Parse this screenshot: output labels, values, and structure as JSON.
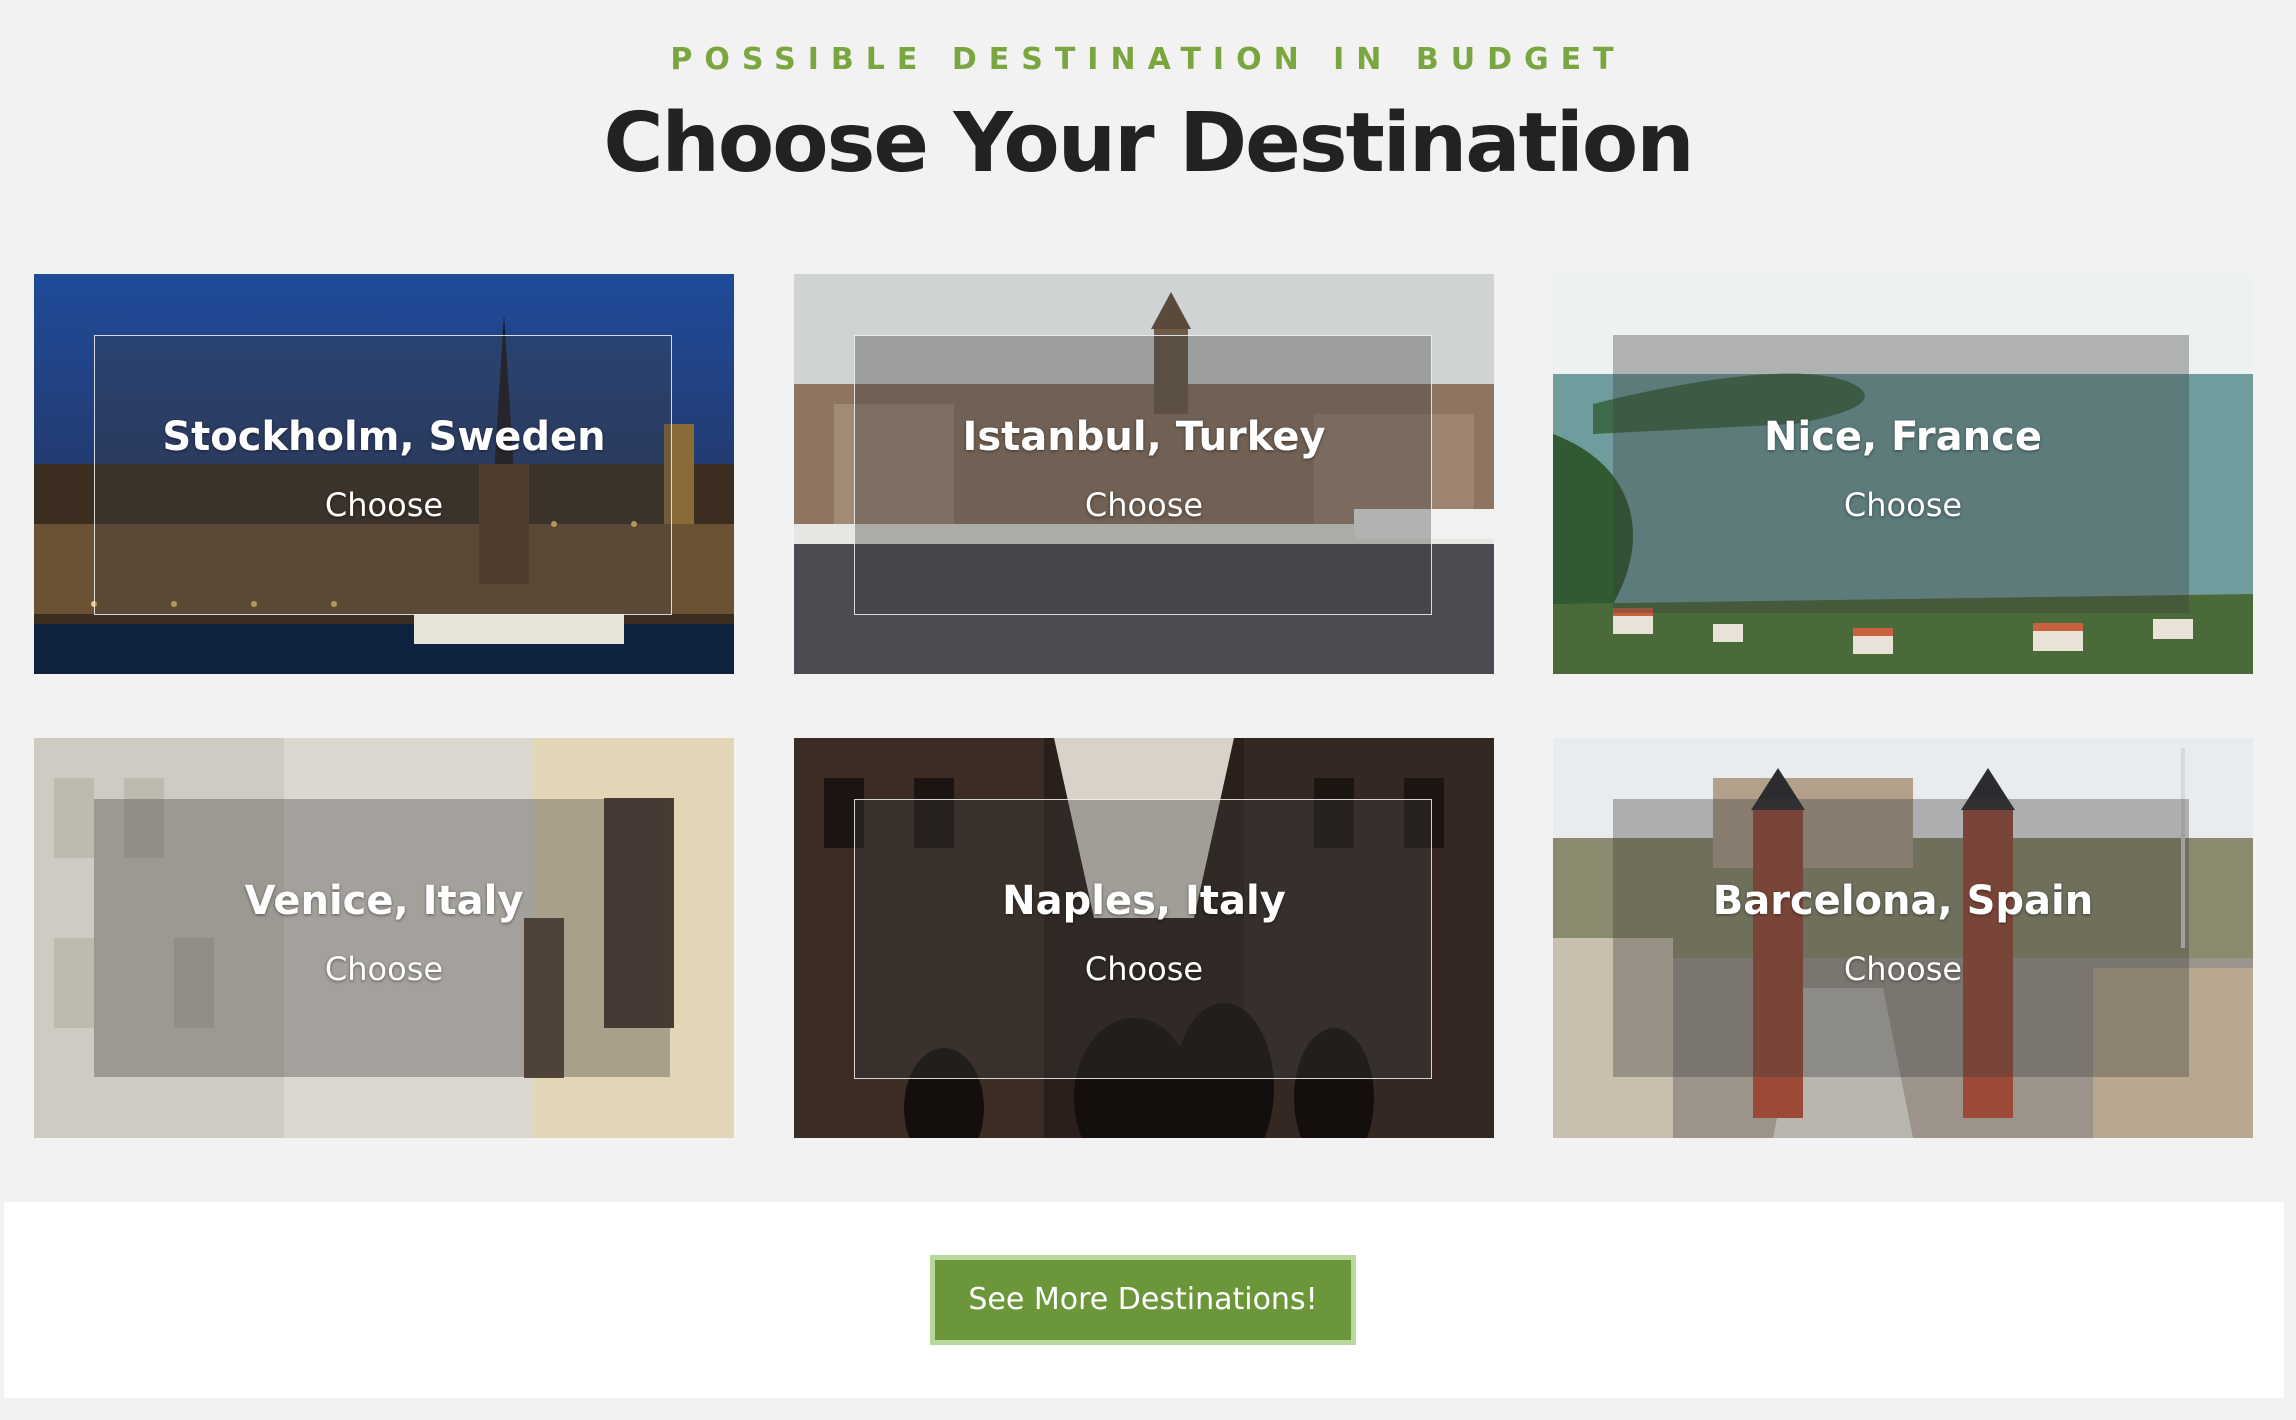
{
  "header": {
    "eyebrow": "POSSIBLE DESTINATION IN BUDGET",
    "title": "Choose Your Destination"
  },
  "destinations": [
    {
      "name": "Stockholm, Sweden",
      "action": "Choose"
    },
    {
      "name": "Istanbul, Turkey",
      "action": "Choose"
    },
    {
      "name": "Nice, France",
      "action": "Choose"
    },
    {
      "name": "Venice, Italy",
      "action": "Choose"
    },
    {
      "name": "Naples, Italy",
      "action": "Choose"
    },
    {
      "name": "Barcelona, Spain",
      "action": "Choose"
    }
  ],
  "cta": {
    "label": "See More Destinations!"
  },
  "colors": {
    "accent": "#7aa63f",
    "button": "#6c963a",
    "button_border": "#b8d79a",
    "heading": "#222222"
  }
}
